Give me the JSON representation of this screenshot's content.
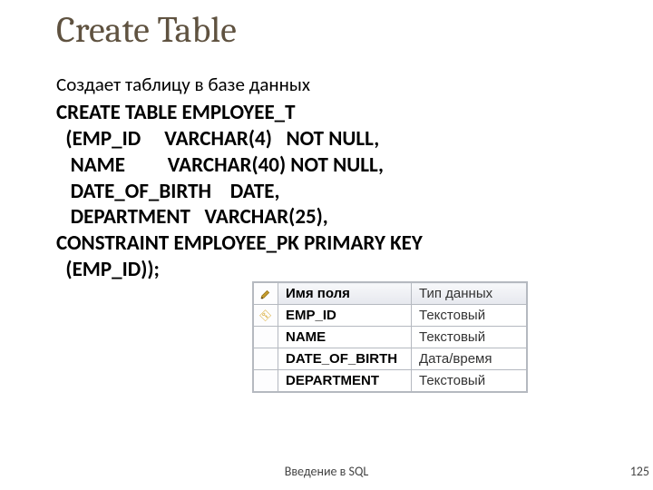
{
  "title": "Create Table",
  "lead": "Создает таблицу в базе данных",
  "sql": {
    "l1": "CREATE TABLE EMPLOYEE_T",
    "l2": "  (EMP_ID     VARCHAR(4)   NOT NULL,",
    "l3": "   NAME         VARCHAR(40) NOT NULL,",
    "l4": "   DATE_OF_BIRTH    DATE,",
    "l5": "   DEPARTMENT   VARCHAR(25),",
    "l6": "CONSTRAINT EMPLOYEE_PK PRIMARY KEY",
    "l7": "  (EMP_ID));"
  },
  "designer": {
    "header_field": "Имя поля",
    "header_type": "Тип данных",
    "rows": [
      {
        "key": true,
        "name": "EMP_ID",
        "type": "Текстовый"
      },
      {
        "key": false,
        "name": "NAME",
        "type": "Текстовый"
      },
      {
        "key": false,
        "name": "DATE_OF_BIRTH",
        "type": "Дата/время"
      },
      {
        "key": false,
        "name": "DEPARTMENT",
        "type": "Текстовый"
      }
    ]
  },
  "footer": "Введение в SQL",
  "page": "125"
}
